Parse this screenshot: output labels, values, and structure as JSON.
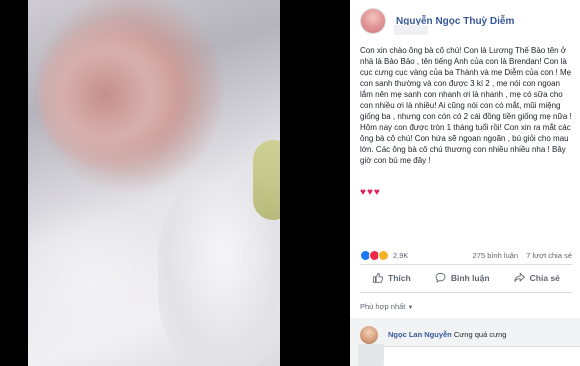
{
  "post": {
    "author": "Nguyễn Ngọc Thuỳ Diễm",
    "text": "Con xin chào ông bà cô chú! Con là Lương Thế Bảo tên ở nhà là Bảo Bảo , tên tiếng Anh của con là Brendan! Con là cục cưng cục vàng của ba Thành và mẹ Diễm của con ! Mẹ con sanh thường và con được 3 kí 2 , mẹ nói con ngoan lắm nên mẹ sanh con nhanh ơi là nhanh , mẹ có sữa cho con nhiều ơi là nhiều! Ai cũng nói con có mắt, mũi miệng giống ba , nhưng con còn có 2 cái đồng tiền giống mẹ nữa ! Hôm nay con được tròn 1 tháng tuổi rồi! Con xin ra mắt các ông bà cô chú! Con hứa sẽ ngoan ngoãn , bú giỏi cho mau lớn. Các ông bà cô chú thương con nhiều nhiều nha ! Bây giờ con bú mẹ đây !",
    "hearts": "♥♥♥"
  },
  "reactions": {
    "count": "2,9K",
    "comments": "275 bình luận",
    "shares": "7 lượt chia sẻ"
  },
  "actions": {
    "like": "Thích",
    "comment": "Bình luận",
    "share": "Chia sẻ"
  },
  "sort_label": "Phù hợp nhất",
  "comment": {
    "author": "Ngọc Lan Nguyễn",
    "text": "Cưng quá cưng"
  },
  "colors": {
    "link": "#385898",
    "like": "#1877f2",
    "love": "#f0284a",
    "heart": "#e0245e"
  }
}
